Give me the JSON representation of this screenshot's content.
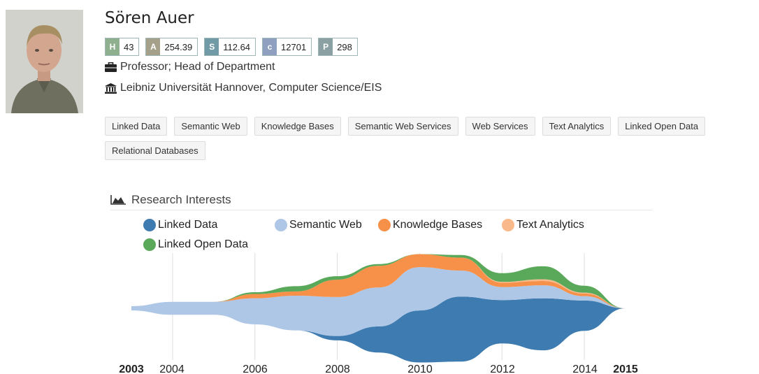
{
  "profile": {
    "name": "Sören Auer",
    "role": "Professor; Head of Department",
    "organization": "Leibniz Universität Hannover, Computer Science/EIS",
    "photo_icon": "person-photo"
  },
  "metrics": [
    {
      "key": "H",
      "value": "43",
      "color": "#8eb08e"
    },
    {
      "key": "A",
      "value": "254.39",
      "color": "#a5a08a"
    },
    {
      "key": "S",
      "value": "112.64",
      "color": "#6f9aa6"
    },
    {
      "key": "c",
      "value": "12701",
      "color": "#8e9fc0"
    },
    {
      "key": "P",
      "value": "298",
      "color": "#8aa0a3"
    }
  ],
  "tags": [
    "Linked Data",
    "Semantic Web",
    "Knowledge Bases",
    "Semantic Web Services",
    "Web Services",
    "Text Analytics",
    "Linked Open Data",
    "Relational Databases"
  ],
  "research": {
    "title": "Research Interests",
    "title_icon": "area-chart-icon"
  },
  "chart_data": {
    "type": "area",
    "title": "Research Interests",
    "x": [
      2003,
      2004,
      2005,
      2006,
      2007,
      2008,
      2009,
      2010,
      2011,
      2012,
      2013,
      2014,
      2015
    ],
    "xlim": [
      2003,
      2015
    ],
    "tick_labels": [
      "2003",
      "2004",
      "2006",
      "2008",
      "2010",
      "2012",
      "2014",
      "2015"
    ],
    "bold_ticks": [
      "2003",
      "2015"
    ],
    "grid_x": [
      2004,
      2006,
      2008,
      2010,
      2012,
      2014
    ],
    "legend_position": "top",
    "series": [
      {
        "name": "Linked Data",
        "color": "#3e7bb0",
        "values": [
          0,
          0,
          0,
          0,
          0,
          0.5,
          3,
          6,
          7.5,
          5,
          6,
          3.5,
          0
        ]
      },
      {
        "name": "Semantic Web",
        "color": "#aec7e6",
        "values": [
          0.5,
          1.5,
          1.5,
          3,
          4,
          4.5,
          4.5,
          5,
          3,
          1.5,
          1.5,
          0.5,
          0
        ]
      },
      {
        "name": "Knowledge Bases",
        "color": "#f7914a",
        "values": [
          0,
          0,
          0,
          0.5,
          0.5,
          2,
          2.5,
          1.5,
          1.5,
          0.5,
          0.5,
          0.3,
          0
        ]
      },
      {
        "name": "Text Analytics",
        "color": "#f9b98a",
        "values": [
          0,
          0,
          0,
          0,
          0,
          0,
          0,
          0,
          0,
          0.1,
          0.2,
          0.1,
          0
        ]
      },
      {
        "name": "Linked Open Data",
        "color": "#5aa85a",
        "values": [
          0,
          0,
          0,
          0.2,
          0.6,
          0.4,
          0.2,
          0,
          0.3,
          1,
          1.5,
          0.8,
          0
        ]
      }
    ]
  }
}
